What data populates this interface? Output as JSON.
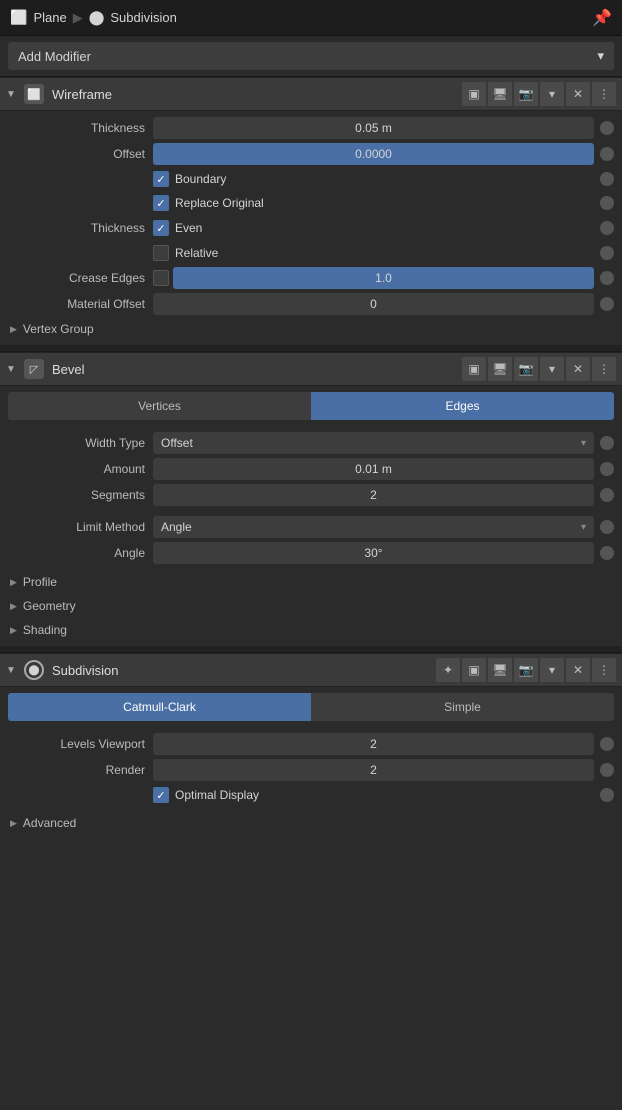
{
  "topbar": {
    "object": "Plane",
    "separator": "▶",
    "modifier": "Subdivision",
    "pin_icon": "📌"
  },
  "add_modifier": {
    "label": "Add Modifier",
    "arrow": "▾"
  },
  "wireframe": {
    "header": {
      "name": "Wireframe",
      "collapse": "▼"
    },
    "thickness": {
      "label": "Thickness",
      "value": "0.05 m"
    },
    "offset": {
      "label": "Offset",
      "value": "0.0000"
    },
    "boundary": {
      "label": "Boundary",
      "checked": true
    },
    "replace_original": {
      "label": "Replace Original",
      "checked": true
    },
    "thickness2": {
      "label": "Thickness"
    },
    "even": {
      "label": "Even",
      "checked": true
    },
    "relative": {
      "label": "Relative",
      "checked": false
    },
    "crease_edges": {
      "label": "Crease Edges",
      "value": "1.0"
    },
    "material_offset": {
      "label": "Material Offset",
      "value": "0"
    },
    "vertex_group": {
      "label": "Vertex Group"
    }
  },
  "bevel": {
    "header": {
      "name": "Bevel",
      "collapse": "▼"
    },
    "tab_vertices": "Vertices",
    "tab_edges": "Edges",
    "width_type": {
      "label": "Width Type",
      "value": "Offset"
    },
    "amount": {
      "label": "Amount",
      "value": "0.01 m"
    },
    "segments": {
      "label": "Segments",
      "value": "2"
    },
    "limit_method": {
      "label": "Limit Method",
      "value": "Angle"
    },
    "angle": {
      "label": "Angle",
      "value": "30°"
    },
    "profile": "Profile",
    "geometry": "Geometry",
    "shading": "Shading"
  },
  "subdivision": {
    "header": {
      "name": "Subdivision",
      "collapse": "▼"
    },
    "tab_catmull": "Catmull-Clark",
    "tab_simple": "Simple",
    "levels_viewport": {
      "label": "Levels Viewport",
      "value": "2"
    },
    "render": {
      "label": "Render",
      "value": "2"
    },
    "optimal_display": {
      "label": "Optimal Display",
      "checked": true
    },
    "advanced": "Advanced"
  },
  "icons": {
    "realtime": "🖥",
    "render": "📷",
    "dropdown_arrow": "▾",
    "close": "✕",
    "dots": "⋮",
    "check": "✓",
    "collapse_right": "▶",
    "collapse_down": "▼",
    "pin": "📌"
  },
  "colors": {
    "active_blue": "#4a6fa5",
    "header_bg": "#3a3a3a",
    "field_bg": "#3d3d3d",
    "body_bg": "#2b2b2b",
    "dot": "#555"
  }
}
